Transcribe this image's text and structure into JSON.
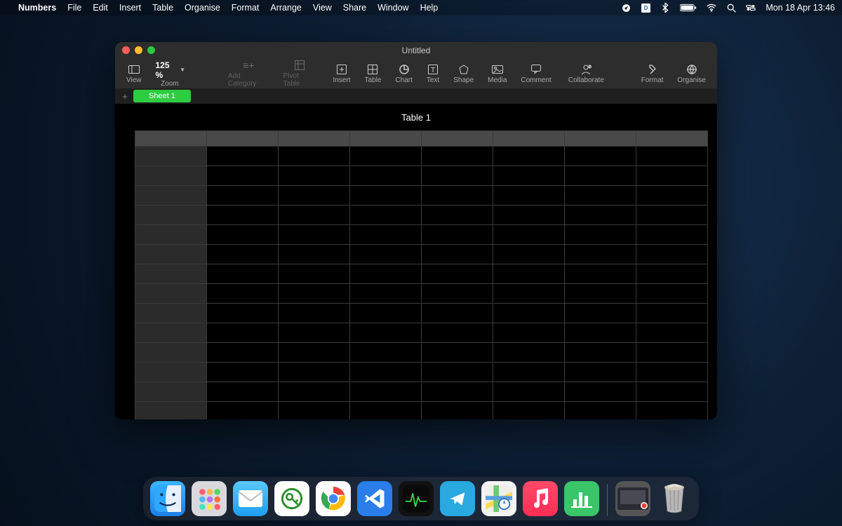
{
  "menubar": {
    "apple": "",
    "app": "Numbers",
    "items": [
      "File",
      "Edit",
      "Insert",
      "Table",
      "Organise",
      "Format",
      "Arrange",
      "View",
      "Share",
      "Window",
      "Help"
    ],
    "clock": "Mon 18 Apr  13:46"
  },
  "window": {
    "title": "Untitled",
    "toolbar": {
      "view": "View",
      "zoom_value": "125 %",
      "zoom_label": "Zoom",
      "add_category": "Add Category",
      "pivot_table": "Pivot Table",
      "insert": "Insert",
      "table": "Table",
      "chart": "Chart",
      "text": "Text",
      "shape": "Shape",
      "media": "Media",
      "comment": "Comment",
      "collaborate": "Collaborate",
      "format": "Format",
      "organise": "Organise"
    },
    "sheet_tab": "Sheet 1",
    "table_title": "Table 1",
    "grid": {
      "rows": 15,
      "cols": 7
    }
  },
  "dock": {
    "apps": [
      "Finder",
      "Launchpad",
      "Mail",
      "Keychain",
      "Chrome",
      "VS Code",
      "Activity Monitor",
      "Telegram",
      "Maps",
      "Music",
      "Numbers"
    ]
  }
}
